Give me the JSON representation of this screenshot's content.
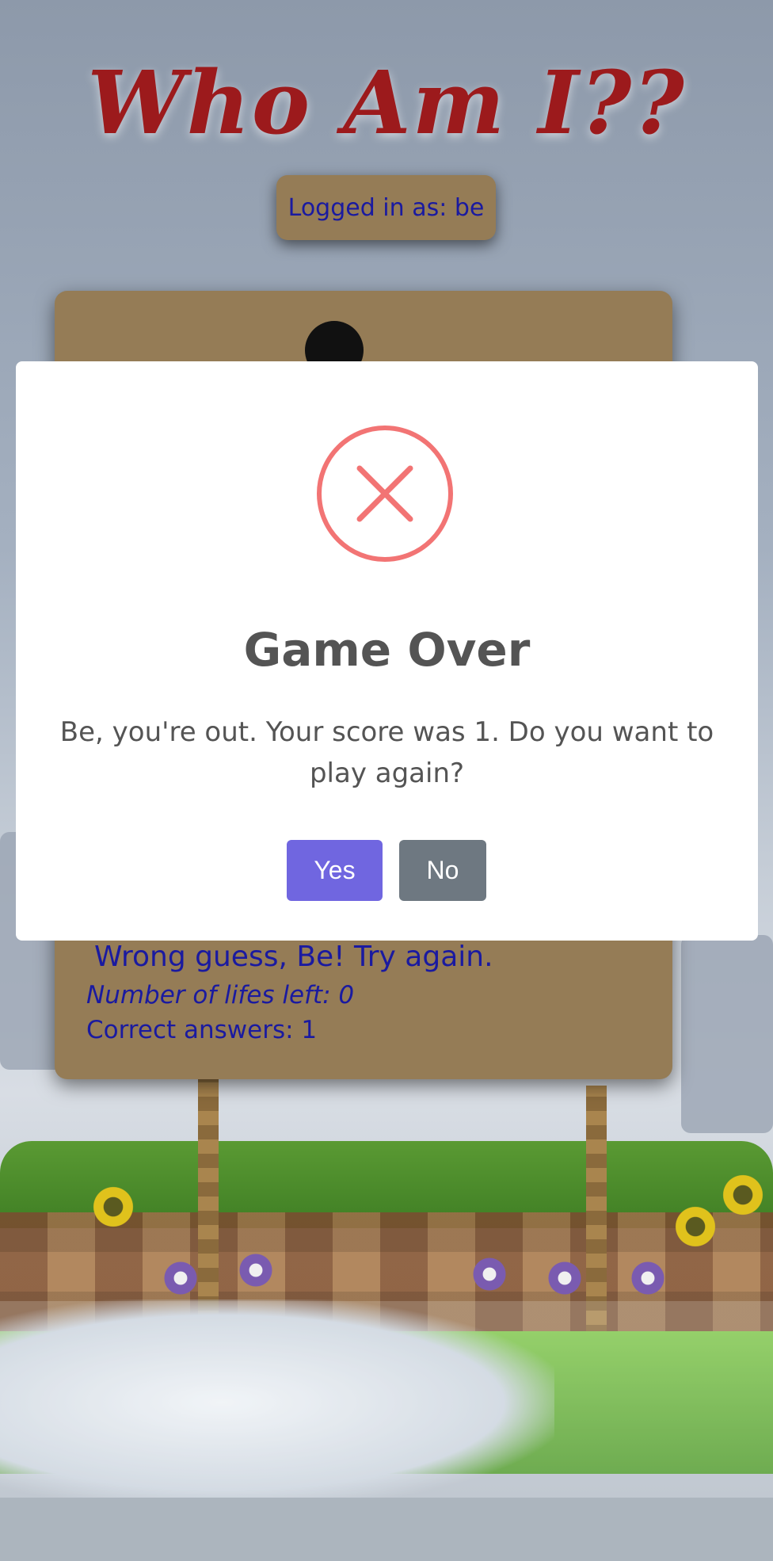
{
  "app": {
    "title": "Who Am I??",
    "login_text": "Logged in as: be"
  },
  "game": {
    "feedback": "Wrong guess, Be! Try again.",
    "lifes_left": "Number of lifes left: 0",
    "correct_answers": "Correct answers: 1"
  },
  "modal": {
    "icon": "error-x-icon",
    "title": "Game Over",
    "message": "Be, you're out. Your score was 1. Do you want to play again?",
    "confirm_label": "Yes",
    "cancel_label": "No"
  },
  "colors": {
    "title": "#9c1a1c",
    "card": "#957c56",
    "link_text": "#1a1aa0",
    "confirm": "#7066e0",
    "cancel": "#6e7881",
    "error_icon": "#f27474"
  }
}
